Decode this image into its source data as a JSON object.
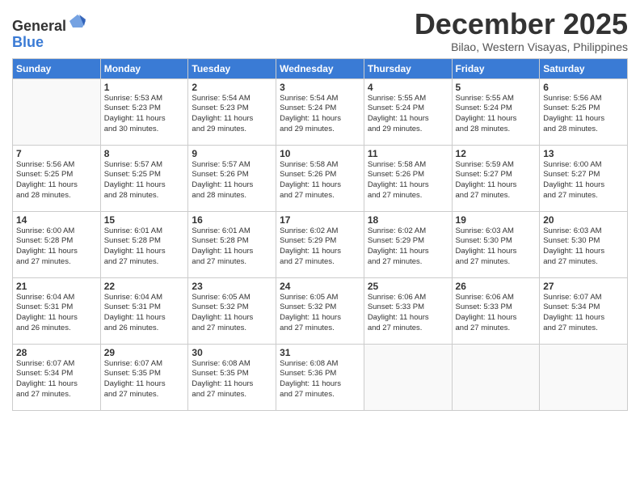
{
  "header": {
    "logo_general": "General",
    "logo_blue": "Blue",
    "month_title": "December 2025",
    "location": "Bilao, Western Visayas, Philippines"
  },
  "weekdays": [
    "Sunday",
    "Monday",
    "Tuesday",
    "Wednesday",
    "Thursday",
    "Friday",
    "Saturday"
  ],
  "weeks": [
    [
      {
        "day": "",
        "info": ""
      },
      {
        "day": "1",
        "info": "Sunrise: 5:53 AM\nSunset: 5:23 PM\nDaylight: 11 hours\nand 30 minutes."
      },
      {
        "day": "2",
        "info": "Sunrise: 5:54 AM\nSunset: 5:23 PM\nDaylight: 11 hours\nand 29 minutes."
      },
      {
        "day": "3",
        "info": "Sunrise: 5:54 AM\nSunset: 5:24 PM\nDaylight: 11 hours\nand 29 minutes."
      },
      {
        "day": "4",
        "info": "Sunrise: 5:55 AM\nSunset: 5:24 PM\nDaylight: 11 hours\nand 29 minutes."
      },
      {
        "day": "5",
        "info": "Sunrise: 5:55 AM\nSunset: 5:24 PM\nDaylight: 11 hours\nand 28 minutes."
      },
      {
        "day": "6",
        "info": "Sunrise: 5:56 AM\nSunset: 5:25 PM\nDaylight: 11 hours\nand 28 minutes."
      }
    ],
    [
      {
        "day": "7",
        "info": "Sunrise: 5:56 AM\nSunset: 5:25 PM\nDaylight: 11 hours\nand 28 minutes."
      },
      {
        "day": "8",
        "info": "Sunrise: 5:57 AM\nSunset: 5:25 PM\nDaylight: 11 hours\nand 28 minutes."
      },
      {
        "day": "9",
        "info": "Sunrise: 5:57 AM\nSunset: 5:26 PM\nDaylight: 11 hours\nand 28 minutes."
      },
      {
        "day": "10",
        "info": "Sunrise: 5:58 AM\nSunset: 5:26 PM\nDaylight: 11 hours\nand 27 minutes."
      },
      {
        "day": "11",
        "info": "Sunrise: 5:58 AM\nSunset: 5:26 PM\nDaylight: 11 hours\nand 27 minutes."
      },
      {
        "day": "12",
        "info": "Sunrise: 5:59 AM\nSunset: 5:27 PM\nDaylight: 11 hours\nand 27 minutes."
      },
      {
        "day": "13",
        "info": "Sunrise: 6:00 AM\nSunset: 5:27 PM\nDaylight: 11 hours\nand 27 minutes."
      }
    ],
    [
      {
        "day": "14",
        "info": "Sunrise: 6:00 AM\nSunset: 5:28 PM\nDaylight: 11 hours\nand 27 minutes."
      },
      {
        "day": "15",
        "info": "Sunrise: 6:01 AM\nSunset: 5:28 PM\nDaylight: 11 hours\nand 27 minutes."
      },
      {
        "day": "16",
        "info": "Sunrise: 6:01 AM\nSunset: 5:28 PM\nDaylight: 11 hours\nand 27 minutes."
      },
      {
        "day": "17",
        "info": "Sunrise: 6:02 AM\nSunset: 5:29 PM\nDaylight: 11 hours\nand 27 minutes."
      },
      {
        "day": "18",
        "info": "Sunrise: 6:02 AM\nSunset: 5:29 PM\nDaylight: 11 hours\nand 27 minutes."
      },
      {
        "day": "19",
        "info": "Sunrise: 6:03 AM\nSunset: 5:30 PM\nDaylight: 11 hours\nand 27 minutes."
      },
      {
        "day": "20",
        "info": "Sunrise: 6:03 AM\nSunset: 5:30 PM\nDaylight: 11 hours\nand 27 minutes."
      }
    ],
    [
      {
        "day": "21",
        "info": "Sunrise: 6:04 AM\nSunset: 5:31 PM\nDaylight: 11 hours\nand 26 minutes."
      },
      {
        "day": "22",
        "info": "Sunrise: 6:04 AM\nSunset: 5:31 PM\nDaylight: 11 hours\nand 26 minutes."
      },
      {
        "day": "23",
        "info": "Sunrise: 6:05 AM\nSunset: 5:32 PM\nDaylight: 11 hours\nand 27 minutes."
      },
      {
        "day": "24",
        "info": "Sunrise: 6:05 AM\nSunset: 5:32 PM\nDaylight: 11 hours\nand 27 minutes."
      },
      {
        "day": "25",
        "info": "Sunrise: 6:06 AM\nSunset: 5:33 PM\nDaylight: 11 hours\nand 27 minutes."
      },
      {
        "day": "26",
        "info": "Sunrise: 6:06 AM\nSunset: 5:33 PM\nDaylight: 11 hours\nand 27 minutes."
      },
      {
        "day": "27",
        "info": "Sunrise: 6:07 AM\nSunset: 5:34 PM\nDaylight: 11 hours\nand 27 minutes."
      }
    ],
    [
      {
        "day": "28",
        "info": "Sunrise: 6:07 AM\nSunset: 5:34 PM\nDaylight: 11 hours\nand 27 minutes."
      },
      {
        "day": "29",
        "info": "Sunrise: 6:07 AM\nSunset: 5:35 PM\nDaylight: 11 hours\nand 27 minutes."
      },
      {
        "day": "30",
        "info": "Sunrise: 6:08 AM\nSunset: 5:35 PM\nDaylight: 11 hours\nand 27 minutes."
      },
      {
        "day": "31",
        "info": "Sunrise: 6:08 AM\nSunset: 5:36 PM\nDaylight: 11 hours\nand 27 minutes."
      },
      {
        "day": "",
        "info": ""
      },
      {
        "day": "",
        "info": ""
      },
      {
        "day": "",
        "info": ""
      }
    ]
  ]
}
